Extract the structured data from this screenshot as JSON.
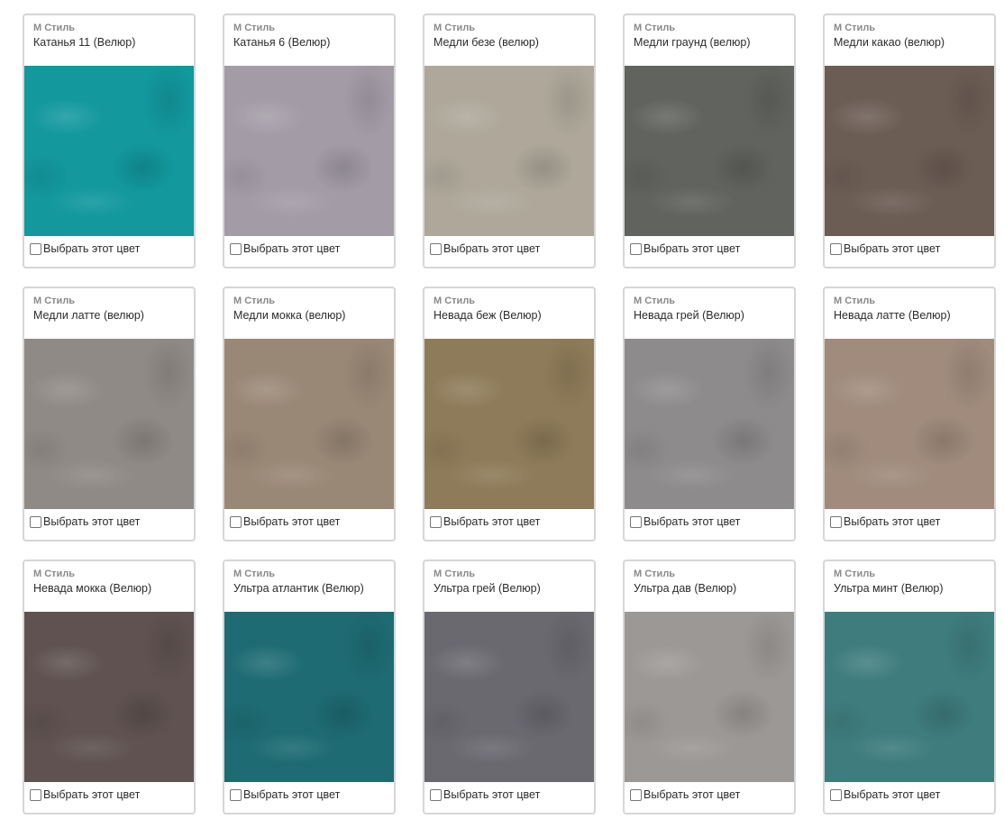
{
  "cards": [
    {
      "brand": "М Стиль",
      "name": "Катанья 11 (Велюр)",
      "color": "#12989d",
      "select_label": "Выбрать этот цвет"
    },
    {
      "brand": "М Стиль",
      "name": "Катанья 6 (Велюр)",
      "color": "#a39ca6",
      "select_label": "Выбрать этот цвет"
    },
    {
      "brand": "М Стиль",
      "name": "Медли безе (велюр)",
      "color": "#aea79a",
      "select_label": "Выбрать этот цвет"
    },
    {
      "brand": "М Стиль",
      "name": "Медли граунд (велюр)",
      "color": "#60635e",
      "select_label": "Выбрать этот цвет"
    },
    {
      "brand": "М Стиль",
      "name": "Медли какао (велюр)",
      "color": "#6c5d54",
      "select_label": "Выбрать этот цвет"
    },
    {
      "brand": "М Стиль",
      "name": "Медли латте (велюр)",
      "color": "#8f8a86",
      "select_label": "Выбрать этот цвет"
    },
    {
      "brand": "М Стиль",
      "name": "Медли мокка (велюр)",
      "color": "#9a8876",
      "select_label": "Выбрать этот цвет"
    },
    {
      "brand": "М Стиль",
      "name": "Невада беж (Велюр)",
      "color": "#8e7b59",
      "select_label": "Выбрать этот цвет"
    },
    {
      "brand": "М Стиль",
      "name": "Невада грей (Велюр)",
      "color": "#8d8b8c",
      "select_label": "Выбрать этот цвет"
    },
    {
      "brand": "М Стиль",
      "name": "Невада латте (Велюр)",
      "color": "#a08b7c",
      "select_label": "Выбрать этот цвет"
    },
    {
      "brand": "М Стиль",
      "name": "Невада мокка (Велюр)",
      "color": "#5f5250",
      "select_label": "Выбрать этот цвет"
    },
    {
      "brand": "М Стиль",
      "name": "Ультра атлантик (Велюр)",
      "color": "#1e6b73",
      "select_label": "Выбрать этот цвет"
    },
    {
      "brand": "М Стиль",
      "name": "Ультра грей (Велюр)",
      "color": "#6a6970",
      "select_label": "Выбрать этот цвет"
    },
    {
      "brand": "М Стиль",
      "name": "Ультра дав (Велюр)",
      "color": "#9b9896",
      "select_label": "Выбрать этот цвет"
    },
    {
      "brand": "М Стиль",
      "name": "Ультра минт (Велюр)",
      "color": "#3f7c7d",
      "select_label": "Выбрать этот цвет"
    }
  ]
}
